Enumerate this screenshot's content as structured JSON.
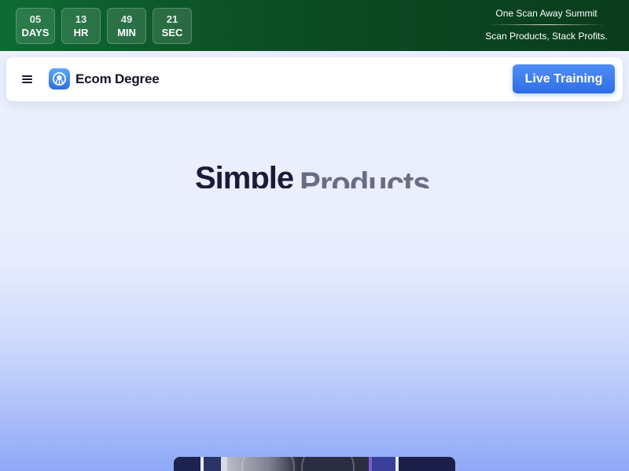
{
  "countdown": [
    {
      "value": "05",
      "unit": "DAYS"
    },
    {
      "value": "13",
      "unit": "HR"
    },
    {
      "value": "49",
      "unit": "MIN"
    },
    {
      "value": "21",
      "unit": "SEC"
    }
  ],
  "promo": {
    "title": "One Scan Away Summit",
    "subtitle": "Scan Products, Stack Profits."
  },
  "nav": {
    "menu_icon": "hamburger-menu-icon",
    "brand_name": "Ecom Degree",
    "brand_logo_icon": "ecom-degree-logo-icon",
    "cta_label": "Live Training"
  },
  "hero": {
    "word_1": "Simple",
    "word_2": "Products"
  },
  "colors": {
    "top_bar": "#0c4f25",
    "accent_blue": "#3b7cf0",
    "heading_dark": "#1b1b38",
    "heading_muted": "#6a6c85"
  }
}
